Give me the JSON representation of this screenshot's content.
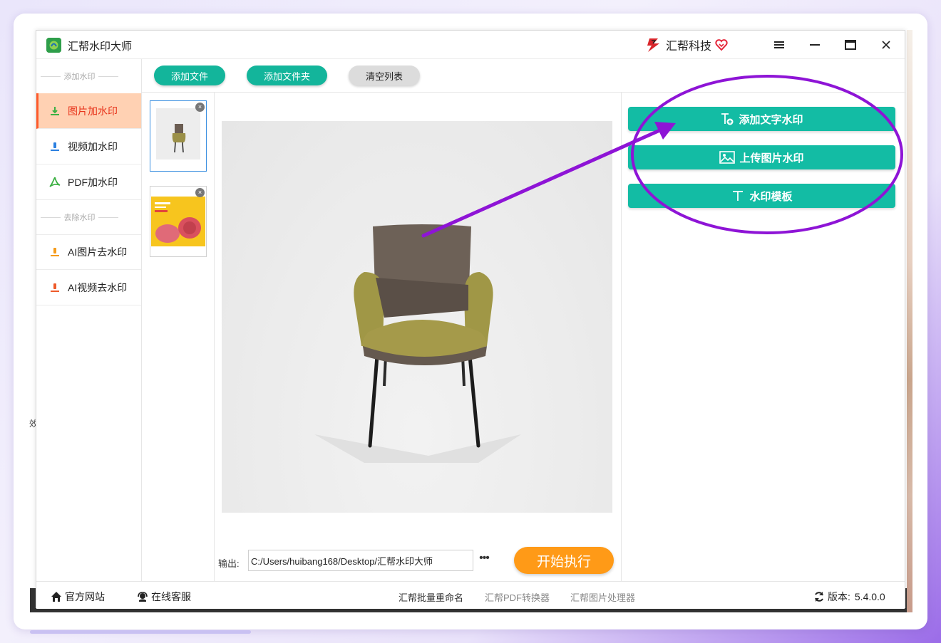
{
  "window": {
    "title": "汇帮水印大师",
    "brand": "汇帮科技"
  },
  "sidebar": {
    "section_add": "添加水印",
    "section_remove": "去除水印",
    "items": [
      {
        "label": "图片加水印",
        "active": true
      },
      {
        "label": "视频加水印"
      },
      {
        "label": "PDF加水印"
      },
      {
        "label": "AI图片去水印"
      },
      {
        "label": "AI视频去水印"
      }
    ]
  },
  "toolbar": {
    "add_file": "添加文件",
    "add_folder": "添加文件夹",
    "clear_list": "清空列表"
  },
  "thumbnails": [
    {
      "kind": "chair",
      "selected": true,
      "close": "×"
    },
    {
      "kind": "yellow-bags",
      "selected": false,
      "close": "×"
    }
  ],
  "output": {
    "label": "输出:",
    "path": "C:/Users/huibang168/Desktop/汇帮水印大师",
    "more": "•••"
  },
  "start_button": "开始执行",
  "watermark_actions": {
    "add_text": "添加文字水印",
    "upload_image": "上传图片水印",
    "templates": "水印模板"
  },
  "footer": {
    "website": "官方网站",
    "support": "在线客服",
    "link_rename": "汇帮批量重命名",
    "link_pdf": "汇帮PDF转换器",
    "link_image": "汇帮图片处理器",
    "version_label": "版本:",
    "version": "5.4.0.0"
  },
  "background": {
    "partial_text": "效"
  },
  "colors": {
    "accent_green": "#13bca4",
    "active_orange": "#ff5a2a",
    "start_orange": "#ff9a17",
    "annotation_purple": "#8e14d6"
  }
}
